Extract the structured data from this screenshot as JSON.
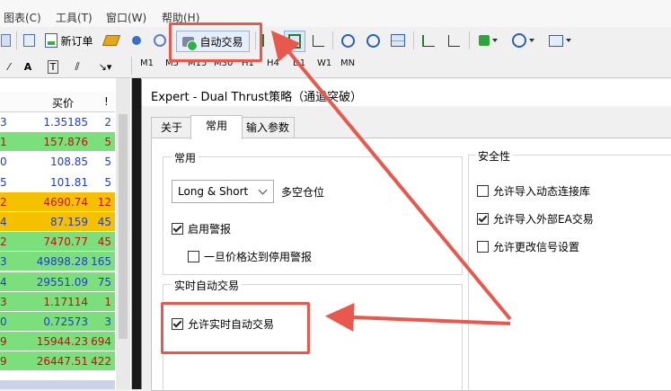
{
  "menu": {
    "items": [
      "图表(C)",
      "工具(T)",
      "窗口(W)",
      "帮助(H)"
    ]
  },
  "toolbar": {
    "new_order": "新订单",
    "auto_trading": "自动交易"
  },
  "timeframes": [
    "M1",
    "M5",
    "M15",
    "M30",
    "H1",
    "H4",
    "D1",
    "W1",
    "MN"
  ],
  "market": {
    "bid_header": "买价",
    "spread_header": "!",
    "rows": [
      {
        "sym": "3",
        "bid": "1.35185",
        "spread": "2",
        "bg": "#ffffff",
        "color": "#1f3cd0"
      },
      {
        "sym": "1",
        "bid": "157.876",
        "spread": "5",
        "bg": "#7be07b",
        "color": "#c01010"
      },
      {
        "sym": "0",
        "bid": "108.85",
        "spread": "5",
        "bg": "#ffffff",
        "color": "#1f3cd0"
      },
      {
        "sym": "5",
        "bid": "101.81",
        "spread": "5",
        "bg": "#ffffff",
        "color": "#1f3cd0"
      },
      {
        "sym": "2",
        "bid": "4690.74",
        "spread": "12",
        "bg": "#f5c000",
        "color": "#c01010"
      },
      {
        "sym": "4",
        "bid": "87.159",
        "spread": "45",
        "bg": "#f5c000",
        "color": "#1f3cd0"
      },
      {
        "sym": "2",
        "bid": "7470.77",
        "spread": "45",
        "bg": "#7be07b",
        "color": "#c01010"
      },
      {
        "sym": "3",
        "bid": "49898.28",
        "spread": "165",
        "bg": "#7be07b",
        "color": "#1f3cd0"
      },
      {
        "sym": "4",
        "bid": "29551.09",
        "spread": "75",
        "bg": "#7be07b",
        "color": "#1f3cd0"
      },
      {
        "sym": "3",
        "bid": "1.17114",
        "spread": "1",
        "bg": "#7be07b",
        "color": "#c01010"
      },
      {
        "sym": "0",
        "bid": "0.72573",
        "spread": "3",
        "bg": "#7be07b",
        "color": "#1f3cd0"
      },
      {
        "sym": "9",
        "bid": "15944.23",
        "spread": "694",
        "bg": "#7be07b",
        "color": "#c01010"
      },
      {
        "sym": "9",
        "bid": "26447.51",
        "spread": "422",
        "bg": "#7be07b",
        "color": "#c01010"
      }
    ]
  },
  "dialog": {
    "title": "Expert - Dual Thrust策略（通道突破）",
    "tabs": [
      "关于",
      "常用",
      "输入参数"
    ],
    "common_group": "常用",
    "mode_value": "Long & Short",
    "mode_label": "多空仓位",
    "enable_alerts": "启用警报",
    "disable_alert_on_hit": "一旦价格达到停用警报",
    "live_group": "实时自动交易",
    "allow_live": "允许实时自动交易",
    "safety_group": "安全性",
    "allow_dll": "允许导入动态连接库",
    "allow_ea_import": "允许导入外部EA交易",
    "allow_signal_change": "允许更改信号设置"
  },
  "colors": {
    "annotation": "#e8584d",
    "selected_row": "#0a246a"
  }
}
